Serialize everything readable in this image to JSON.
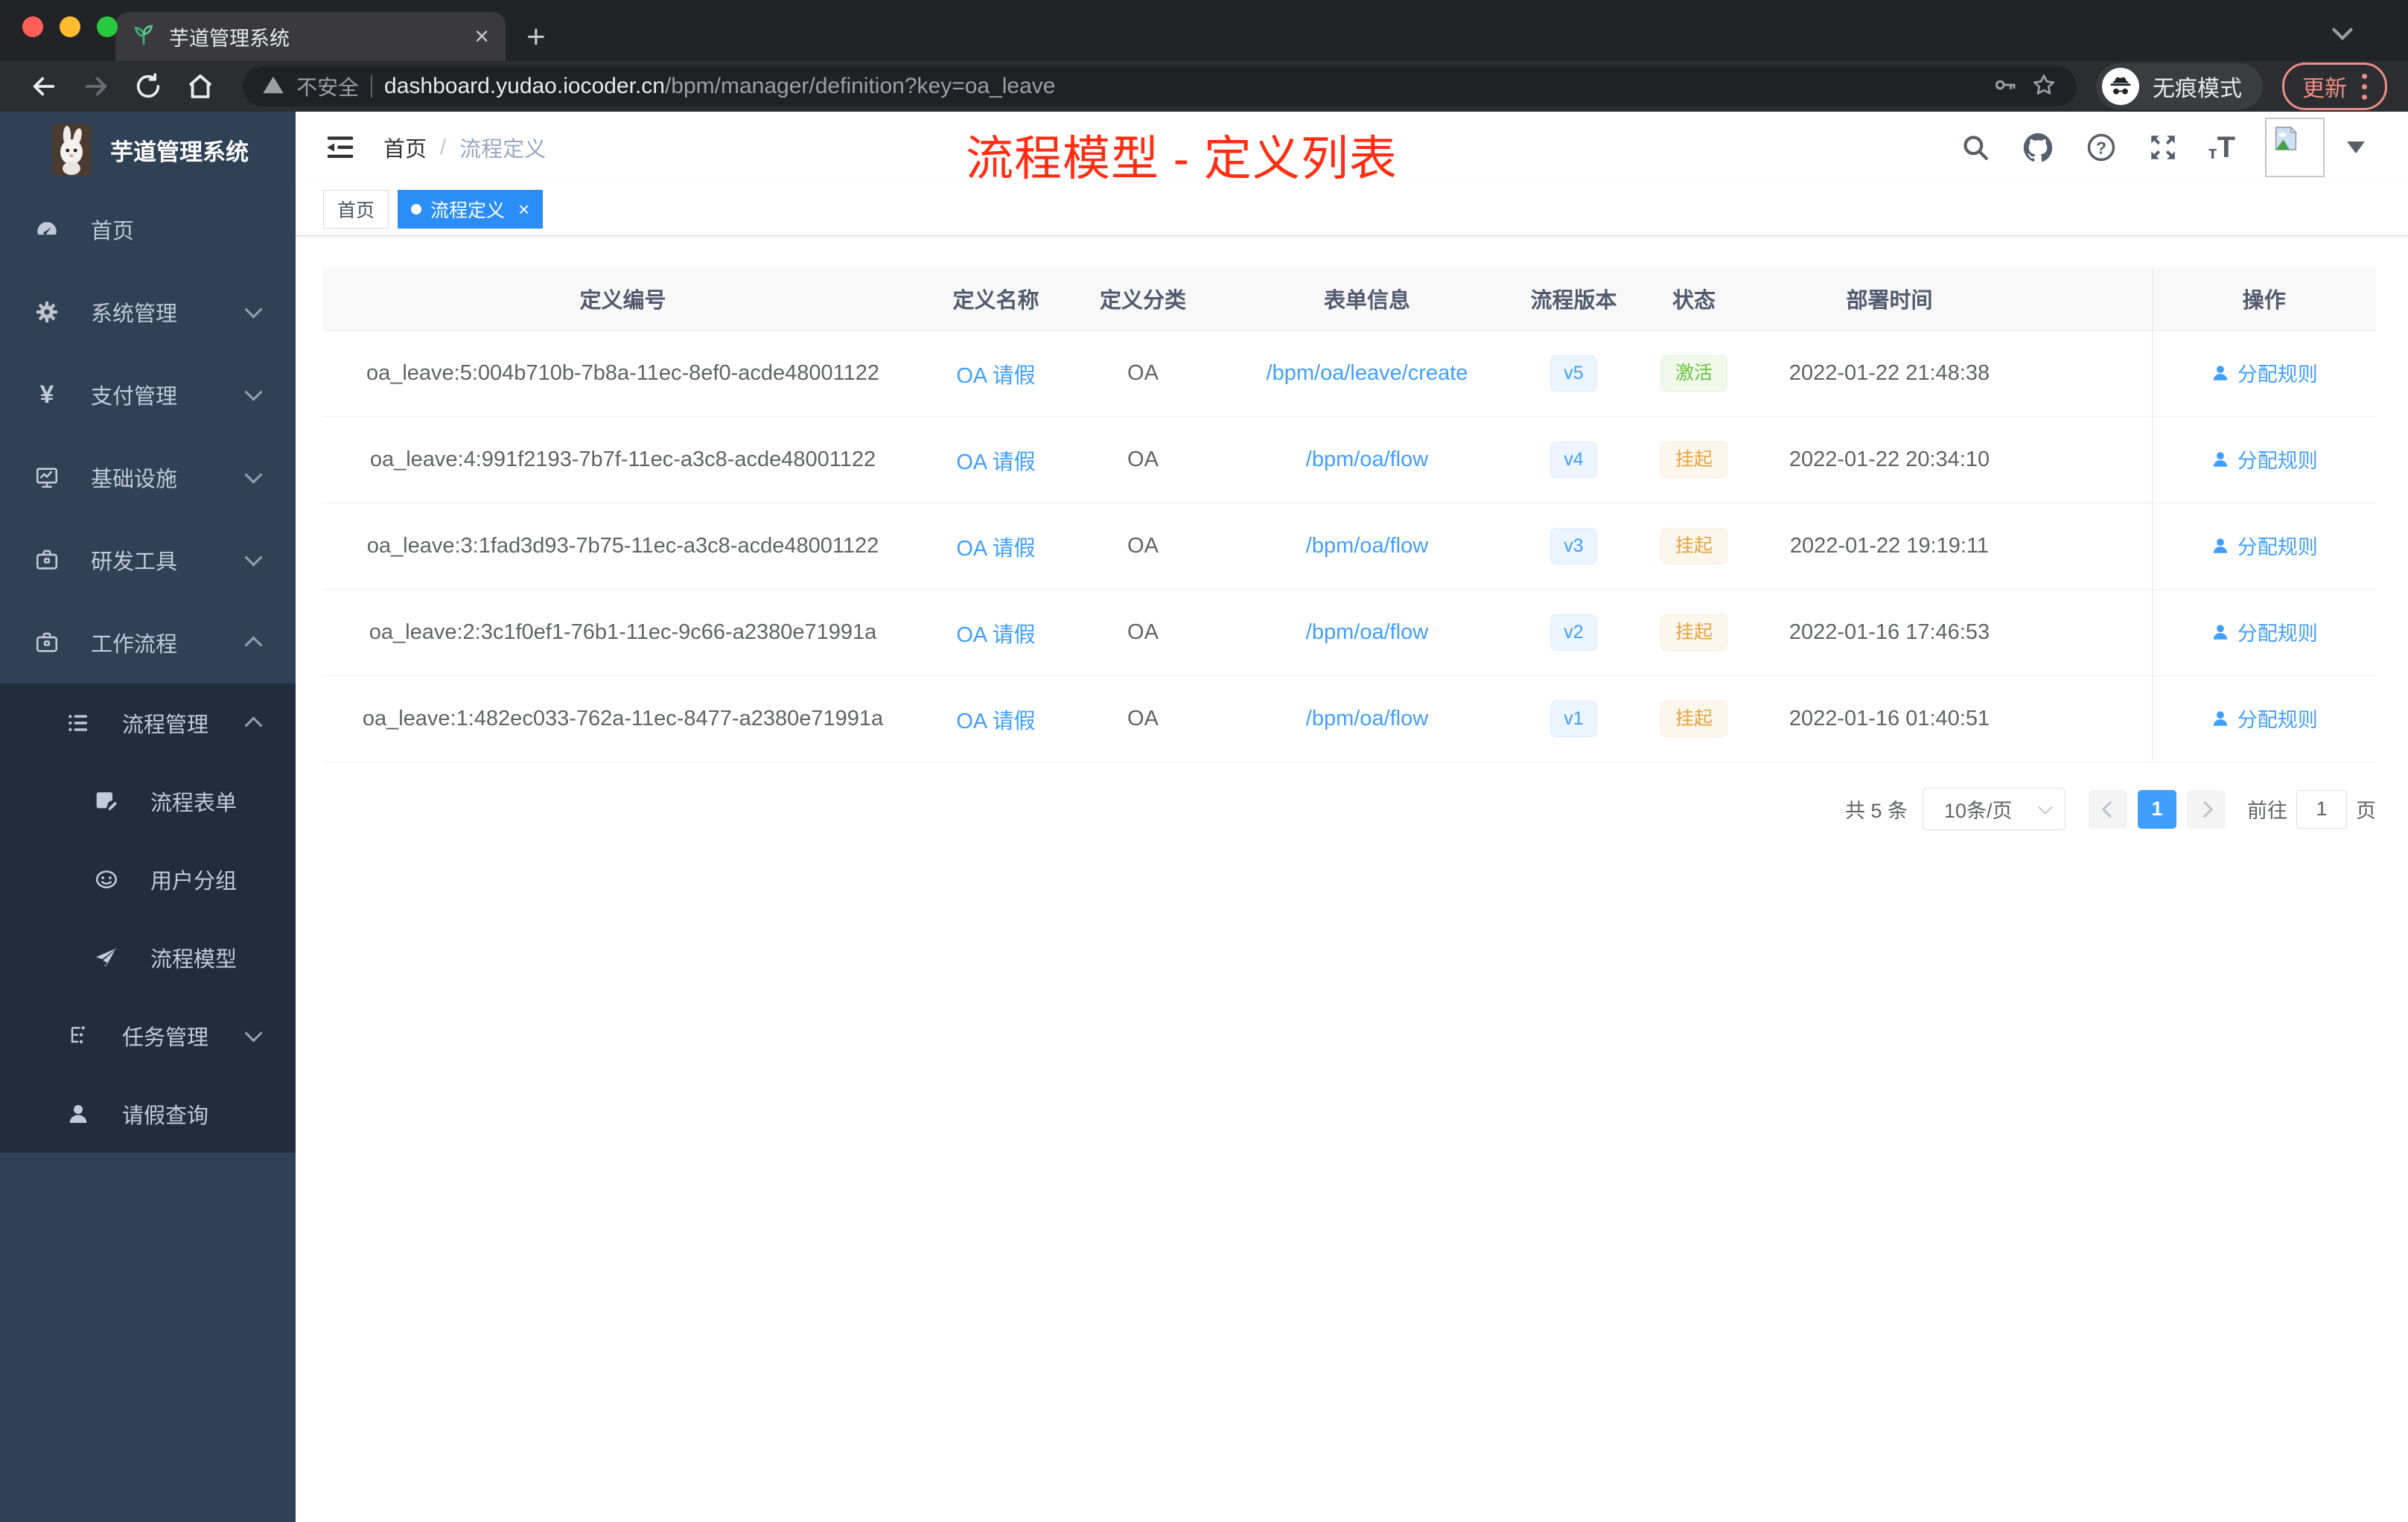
{
  "colors": {
    "accent": "#409eff",
    "active_tag": "#2a8df8",
    "annotation_red": "#ff2d12",
    "success_green": "#67c23a",
    "warning_orange": "#e6a23c",
    "sidebar_bg": "#304156",
    "submenu_bg": "#1f2d3d"
  },
  "browser": {
    "tab_title": "芋道管理系统",
    "security_label": "不安全",
    "url_host": "dashboard.yudao.iocoder.cn",
    "url_path": "/bpm/manager/definition?key=oa_leave",
    "incognito_label": "无痕模式",
    "update_label": "更新"
  },
  "sidebar": {
    "logo_title": "芋道管理系统",
    "items": [
      {
        "label": "首页"
      },
      {
        "label": "系统管理"
      },
      {
        "label": "支付管理"
      },
      {
        "label": "基础设施"
      },
      {
        "label": "研发工具"
      },
      {
        "label": "工作流程"
      },
      {
        "label": "流程管理"
      },
      {
        "label": "流程表单"
      },
      {
        "label": "用户分组"
      },
      {
        "label": "流程模型"
      },
      {
        "label": "任务管理"
      },
      {
        "label": "请假查询"
      }
    ]
  },
  "header": {
    "breadcrumb_home": "首页",
    "breadcrumb_sep": "/",
    "breadcrumb_current": "流程定义",
    "annotation": "流程模型 - 定义列表"
  },
  "tags": {
    "home": "首页",
    "active": "流程定义"
  },
  "table": {
    "columns": [
      "定义编号",
      "定义名称",
      "定义分类",
      "表单信息",
      "流程版本",
      "状态",
      "部署时间",
      "操作"
    ],
    "action_label": "分配规则",
    "rows": [
      {
        "id": "oa_leave:5:004b710b-7b8a-11ec-8ef0-acde48001122",
        "name": "OA 请假",
        "category": "OA",
        "form": "/bpm/oa/leave/create",
        "version": "v5",
        "status": "激活",
        "status_type": "success",
        "time": "2022-01-22 21:48:38"
      },
      {
        "id": "oa_leave:4:991f2193-7b7f-11ec-a3c8-acde48001122",
        "name": "OA 请假",
        "category": "OA",
        "form": "/bpm/oa/flow",
        "version": "v4",
        "status": "挂起",
        "status_type": "warning",
        "time": "2022-01-22 20:34:10"
      },
      {
        "id": "oa_leave:3:1fad3d93-7b75-11ec-a3c8-acde48001122",
        "name": "OA 请假",
        "category": "OA",
        "form": "/bpm/oa/flow",
        "version": "v3",
        "status": "挂起",
        "status_type": "warning",
        "time": "2022-01-22 19:19:11"
      },
      {
        "id": "oa_leave:2:3c1f0ef1-76b1-11ec-9c66-a2380e71991a",
        "name": "OA 请假",
        "category": "OA",
        "form": "/bpm/oa/flow",
        "version": "v2",
        "status": "挂起",
        "status_type": "warning",
        "time": "2022-01-16 17:46:53"
      },
      {
        "id": "oa_leave:1:482ec033-762a-11ec-8477-a2380e71991a",
        "name": "OA 请假",
        "category": "OA",
        "form": "/bpm/oa/flow",
        "version": "v1",
        "status": "挂起",
        "status_type": "warning",
        "time": "2022-01-16 01:40:51"
      }
    ]
  },
  "pagination": {
    "total": "共 5 条",
    "page_size": "10条/页",
    "current": "1",
    "goto": "前往",
    "unit": "页",
    "goto_value": "1"
  },
  "icons": {
    "yen": "¥",
    "question": "?",
    "font_small": "т",
    "font_big": "T",
    "close": "×",
    "plus": "+"
  }
}
